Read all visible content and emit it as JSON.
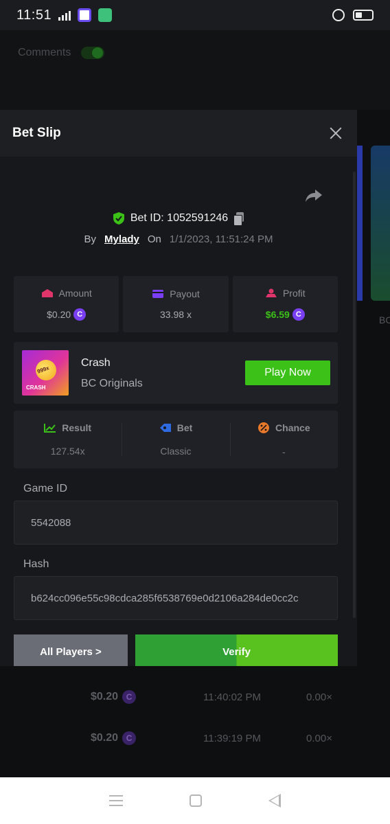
{
  "status_bar": {
    "time": "11:51",
    "network": "4G"
  },
  "background": {
    "comments_label": "Comments",
    "side_label": "BC",
    "rows": [
      {
        "amount": "$0.20",
        "time": "11:40:02 PM",
        "multiplier": "0.00×"
      },
      {
        "amount": "$0.20",
        "time": "11:39:19 PM",
        "multiplier": "0.00×"
      }
    ]
  },
  "modal": {
    "title": "Bet Slip",
    "bet_id": "Bet ID: 1052591246",
    "by_label": "By",
    "username": "Mylady",
    "on_label": "On",
    "date": "1/1/2023, 11:51:24 PM",
    "stats": {
      "amount": {
        "label": "Amount",
        "value": "$0.20"
      },
      "payout": {
        "label": "Payout",
        "value": "33.98 x"
      },
      "profit": {
        "label": "Profit",
        "value": "$6.59"
      }
    },
    "game": {
      "thumb_number": "999x",
      "thumb_label": "CRASH",
      "name": "Crash",
      "provider": "BC Originals",
      "play_label": "Play Now"
    },
    "result": {
      "result_label": "Result",
      "result_value": "127.54x",
      "bet_label": "Bet",
      "bet_value": "Classic",
      "chance_label": "Chance",
      "chance_value": "-"
    },
    "game_id_label": "Game ID",
    "game_id_value": "5542088",
    "hash_label": "Hash",
    "hash_value": "b624cc096e55c98cdca285f6538769e0d2106a284de0cc2c",
    "all_players_label": "All Players >",
    "verify_label": "Verify",
    "coin_symbol": "C"
  },
  "colors": {
    "accent_green": "#3bc117",
    "coin_purple": "#7a3ff2"
  }
}
